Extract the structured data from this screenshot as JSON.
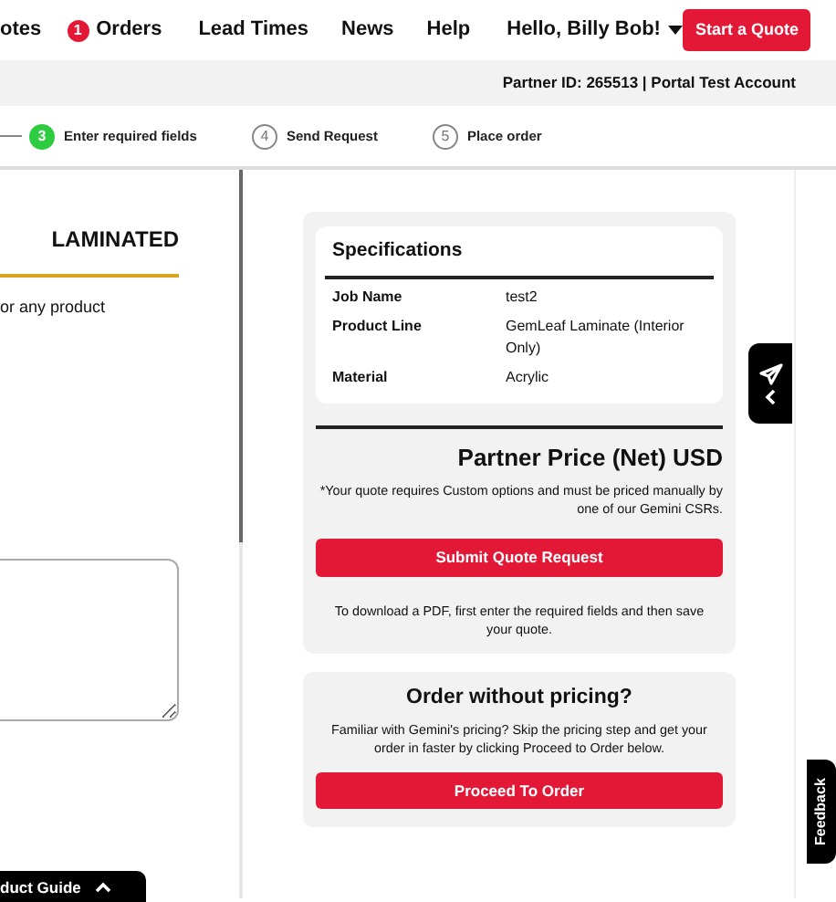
{
  "nav": {
    "items": [
      {
        "label": "otes"
      },
      {
        "label": "Orders",
        "badge": "1"
      },
      {
        "label": "Lead Times"
      },
      {
        "label": "News"
      },
      {
        "label": "Help"
      }
    ],
    "user": "Hello, Billy Bob!",
    "cta": "Start a Quote"
  },
  "account_bar": "Partner ID: 265513 | Portal Test Account",
  "steps": [
    {
      "number": "3",
      "label": "Enter required fields",
      "selected": true
    },
    {
      "number": "4",
      "label": "Send Request",
      "selected": false
    },
    {
      "number": "5",
      "label": "Place order",
      "selected": false
    }
  ],
  "left_panel": {
    "heading": "LAMINATED",
    "text": "or any product"
  },
  "specifications": {
    "title": "Specifications",
    "rows": [
      {
        "label": "Job Name",
        "value": "test2"
      },
      {
        "label": "Product Line",
        "value": "GemLeaf Laminate (Interior Only)"
      },
      {
        "label": "Material",
        "value": "Acrylic"
      }
    ]
  },
  "pricing": {
    "title": "Partner Price (Net) USD",
    "note": "*Your quote requires Custom options and must be priced manually by one of our Gemini CSRs.",
    "button": "Submit Quote Request",
    "pdf_note": "To download a PDF, first enter the required fields and then save your quote."
  },
  "order_without_pricing": {
    "title": "Order without pricing?",
    "text": "Familiar with Gemini's pricing? Skip the pricing step and get your order in faster by clicking Proceed to Order below.",
    "button": "Proceed To Order"
  },
  "feedback_tab": "Feedback",
  "product_guide_tab": "duct Guide"
}
